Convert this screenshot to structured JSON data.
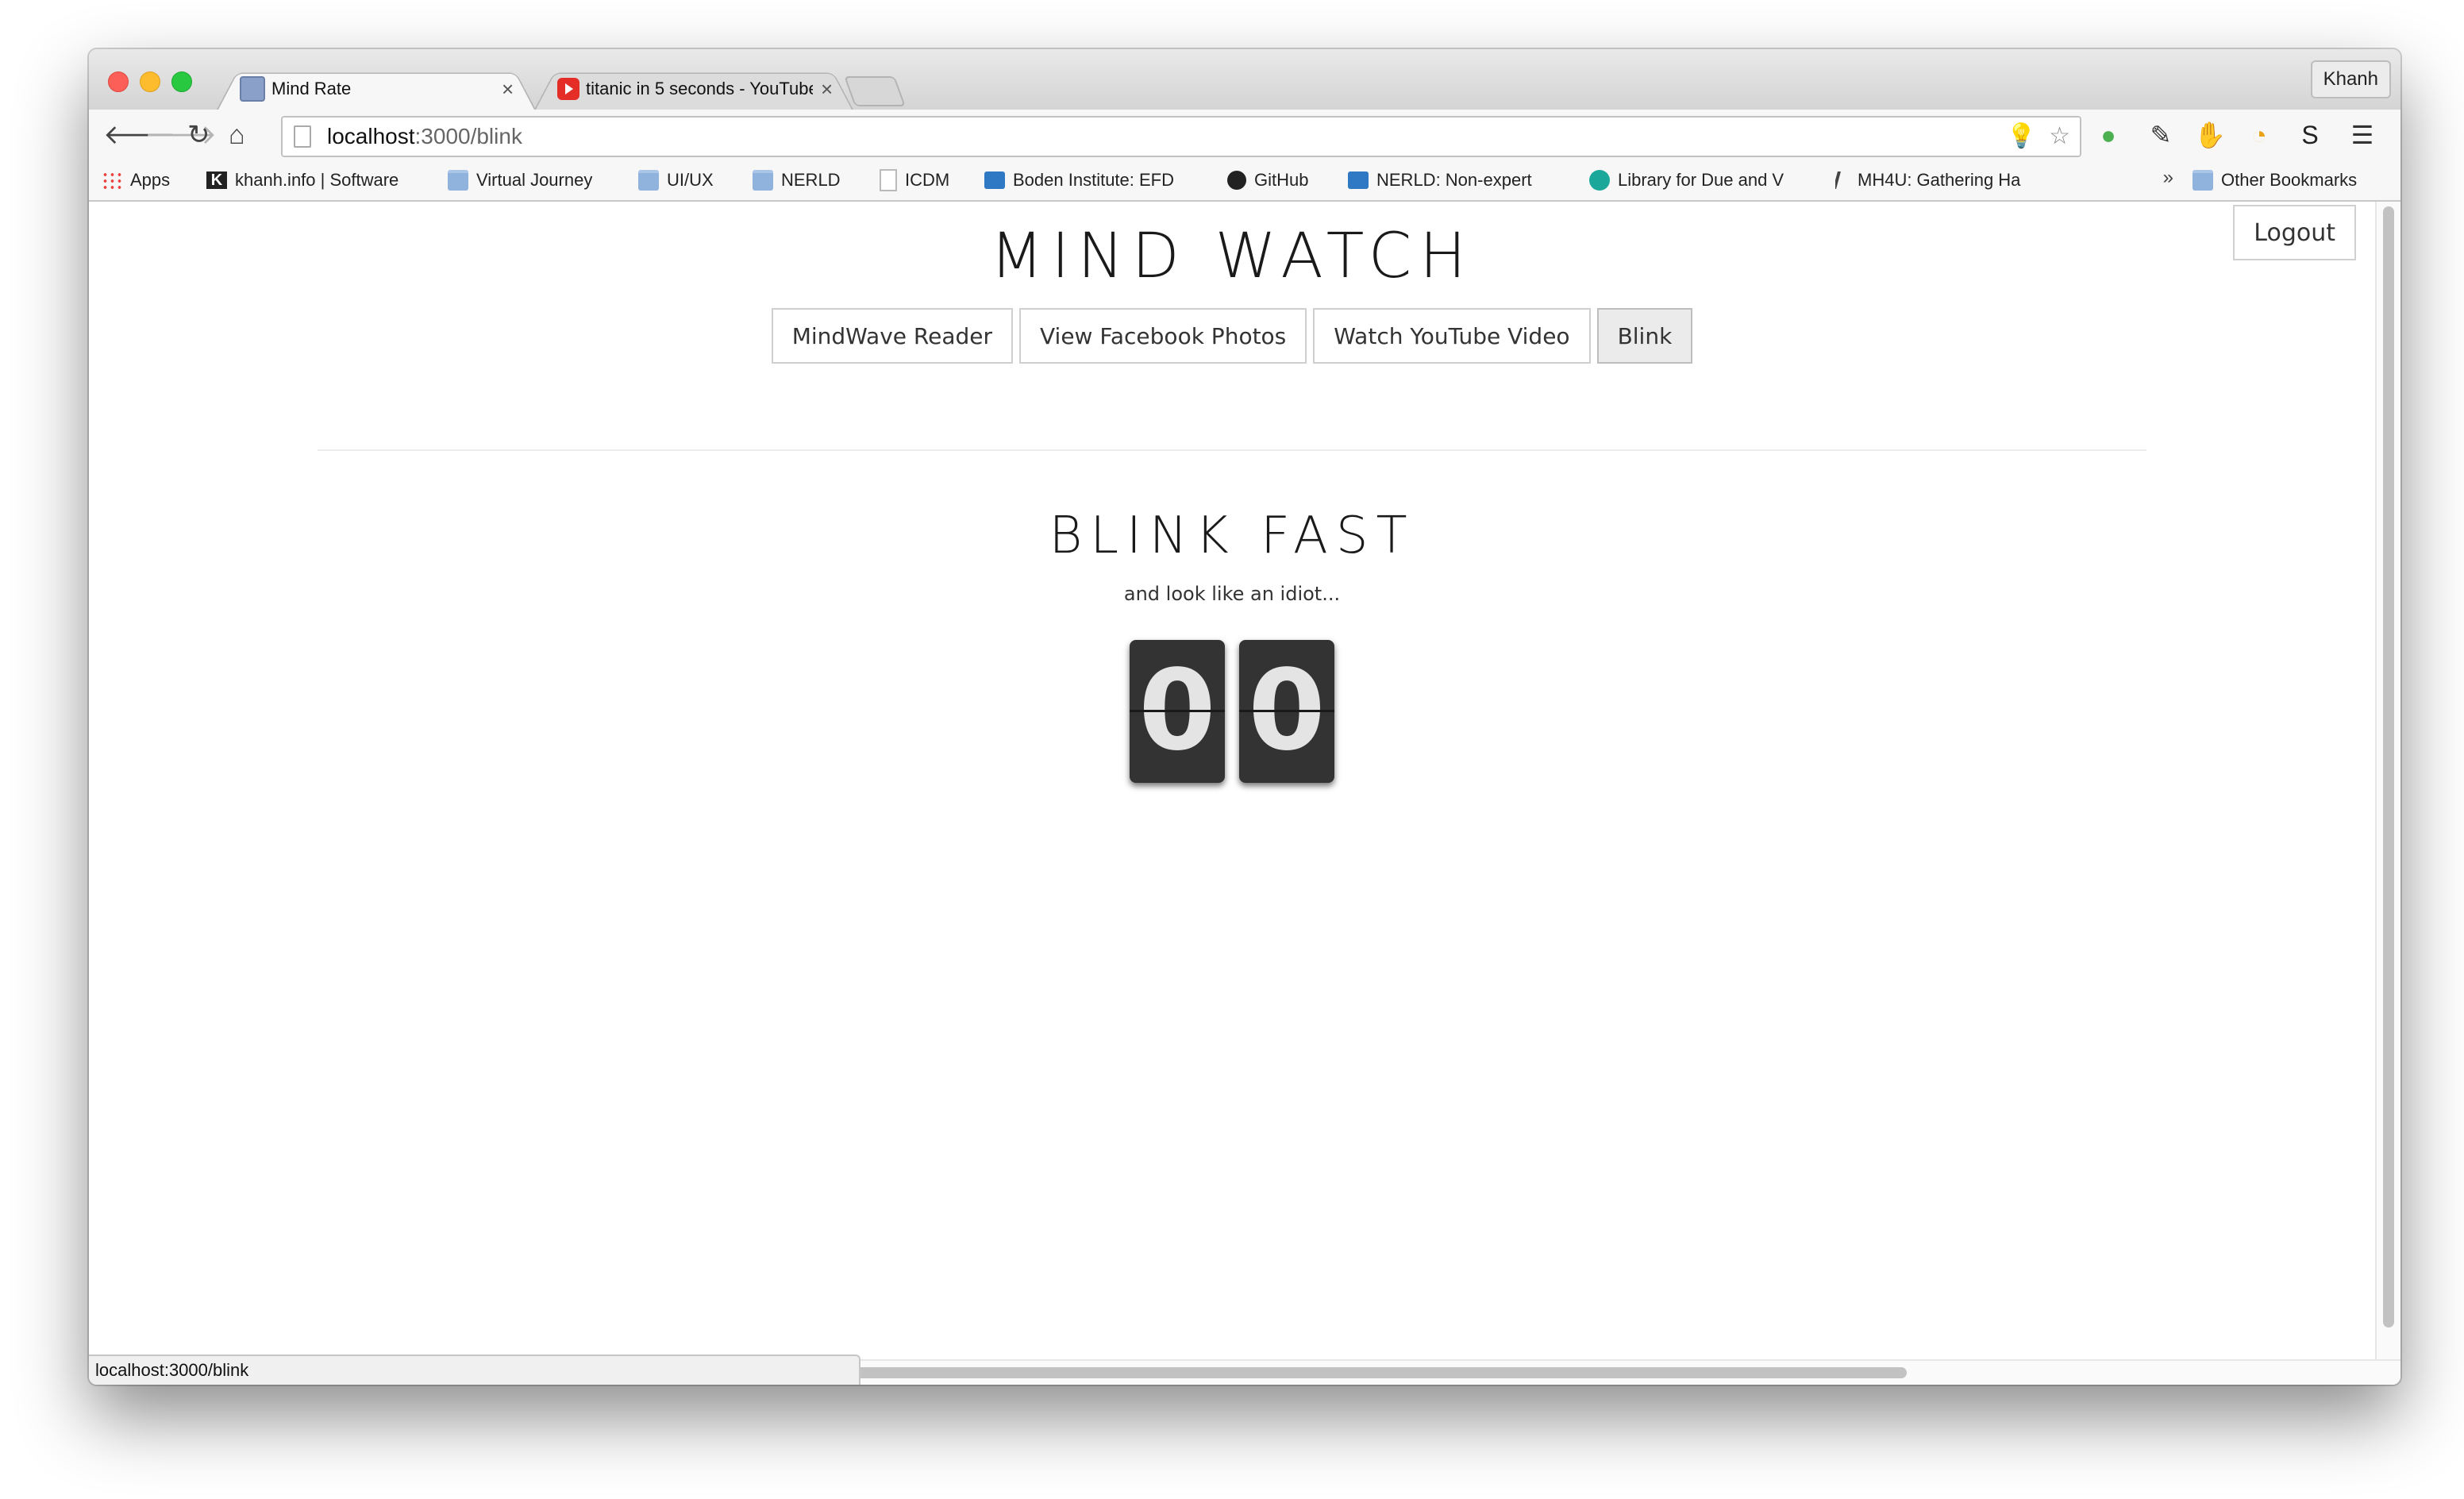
{
  "browser": {
    "tabs": [
      {
        "title": "Mind Rate",
        "active": true
      },
      {
        "title": "titanic in 5 seconds - YouTube",
        "active": false
      }
    ],
    "profile": "Khanh",
    "url_host": "localhost",
    "url_path": ":3000/blink",
    "bookmarks": [
      {
        "label": "Apps",
        "icon": "apps-grid-icon"
      },
      {
        "label": "khanh.info | Software",
        "icon": "k-logo-icon"
      },
      {
        "label": "Virtual Journey",
        "icon": "folder-icon"
      },
      {
        "label": "UI/UX",
        "icon": "folder-icon"
      },
      {
        "label": "NERLD",
        "icon": "folder-icon"
      },
      {
        "label": "ICDM",
        "icon": "document-icon"
      },
      {
        "label": "Boden Institute: EFD",
        "icon": "trello-icon"
      },
      {
        "label": "GitHub",
        "icon": "github-icon"
      },
      {
        "label": "NERLD: Non-expert",
        "icon": "trello-icon"
      },
      {
        "label": "Library for Due and V",
        "icon": "owl-icon"
      },
      {
        "label": "MH4U: Gathering Ha",
        "icon": "quill-icon"
      }
    ],
    "other_bookmarks": "Other Bookmarks",
    "overflow_chevron": "»",
    "status_url": "localhost:3000/blink"
  },
  "page": {
    "logout": "Logout",
    "title": "MIND WATCH",
    "nav": [
      {
        "label": "MindWave Reader",
        "active": false
      },
      {
        "label": "View Facebook Photos",
        "active": false
      },
      {
        "label": "Watch YouTube Video",
        "active": false
      },
      {
        "label": "Blink",
        "active": true
      }
    ],
    "heading": "BLINK FAST",
    "subtitle": "and look like an idiot...",
    "counter_digits": [
      "0",
      "0"
    ]
  }
}
